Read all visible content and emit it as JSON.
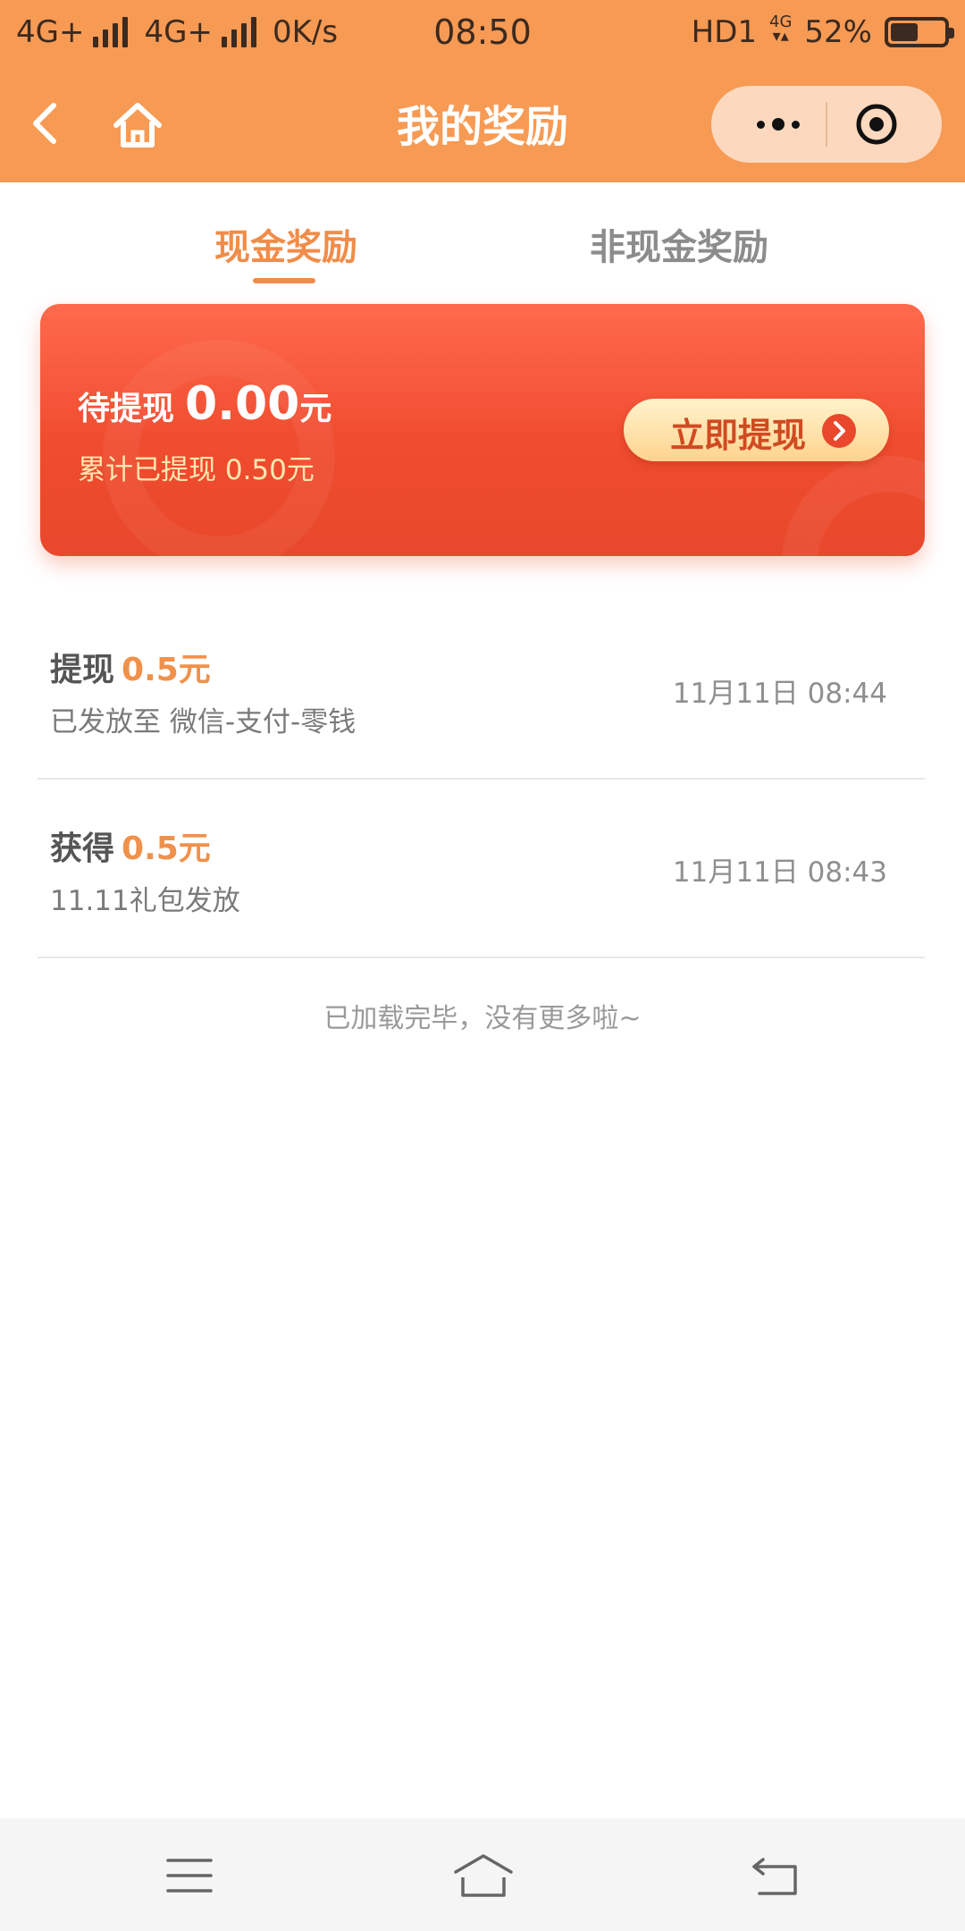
{
  "status_bar": {
    "left_net1": "4G+",
    "left_net2": "4G+",
    "speed": "0K/s",
    "time": "08:50",
    "hd": "HD1",
    "net_mini": "4G",
    "battery": "52%",
    "battery_level": 0.52
  },
  "nav": {
    "title": "我的奖励",
    "icons": [
      "back-icon",
      "home-icon",
      "more-icon",
      "close-miniapp-icon"
    ]
  },
  "tabs": {
    "cash": "现金奖励",
    "noncash": "非现金奖励"
  },
  "card": {
    "pending_label": "待提现",
    "pending_amount": "0.00",
    "pending_unit": "元",
    "cumulative": "累计已提现 0.50元",
    "withdraw_button": "立即提现"
  },
  "records": [
    {
      "type": "提现",
      "amount": "0.5元",
      "desc": "已发放至 微信-支付-零钱",
      "time": "11月11日 08:44"
    },
    {
      "type": "获得",
      "amount": "0.5元",
      "desc": "11.11礼包发放",
      "time": "11月11日 08:43"
    }
  ],
  "footer_note": "已加载完毕，没有更多啦~",
  "colors": {
    "header_bg": "#f79a54",
    "accent": "#f08d4a",
    "card_red": "#f04c2f"
  }
}
